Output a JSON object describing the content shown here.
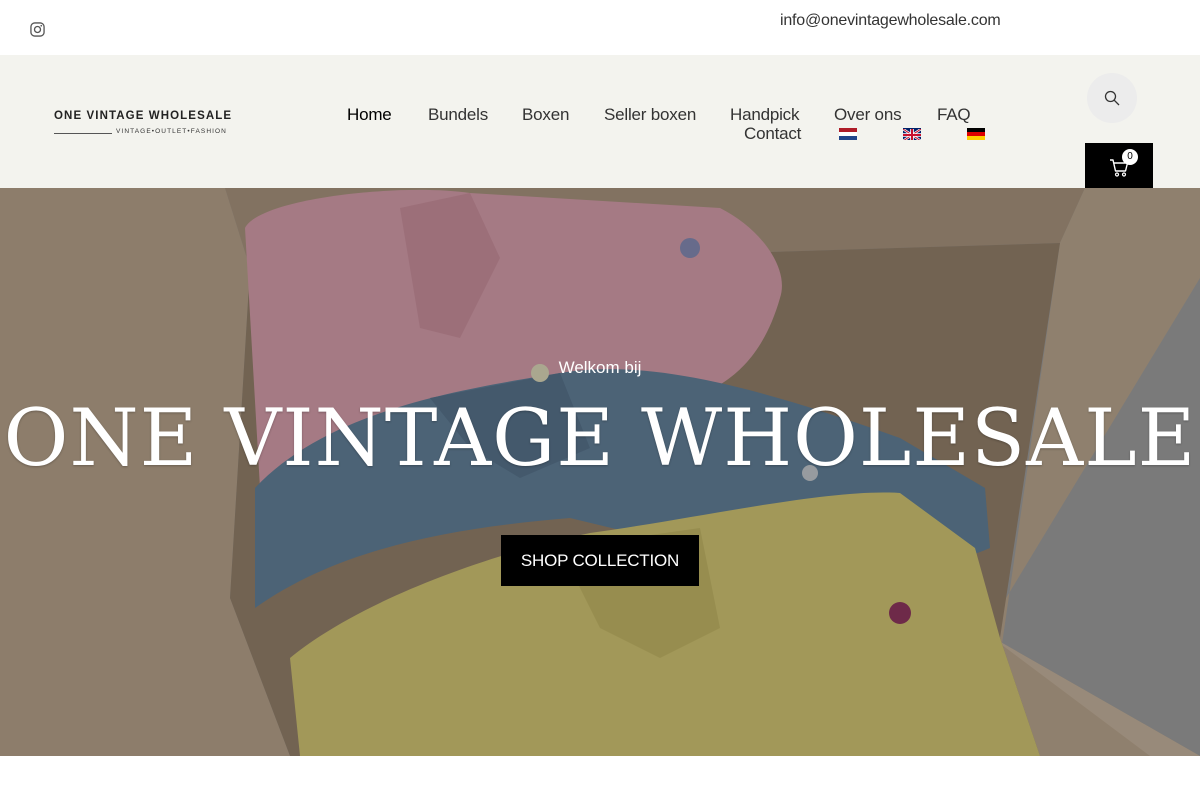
{
  "topbar": {
    "email": "info@onevintagewholesale.com",
    "social_icon": "instagram-icon"
  },
  "logo": {
    "title": "ONE VINTAGE WHOLESALE",
    "tagline": "VINTAGE•OUTLET•FASHION"
  },
  "nav": {
    "items": [
      {
        "label": "Home",
        "active": true
      },
      {
        "label": "Bundels"
      },
      {
        "label": "Boxen"
      },
      {
        "label": "Seller boxen"
      },
      {
        "label": "Handpick"
      },
      {
        "label": "Over ons"
      },
      {
        "label": "FAQ"
      },
      {
        "label": "Contact"
      }
    ],
    "languages": [
      {
        "code": "nl",
        "icon": "flag-netherlands-icon"
      },
      {
        "code": "en",
        "icon": "flag-uk-icon"
      },
      {
        "code": "de",
        "icon": "flag-germany-icon"
      }
    ]
  },
  "search": {
    "icon": "search-icon"
  },
  "cart": {
    "icon": "cart-icon",
    "count": "0"
  },
  "hero": {
    "subtitle": "Welkom bij",
    "title": "ONE VINTAGE WHOLESALE",
    "button": "SHOP COLLECTION"
  },
  "colors": {
    "header_bg": "#f3f3ee",
    "accent": "#000000",
    "hero_text": "#ffffff"
  }
}
